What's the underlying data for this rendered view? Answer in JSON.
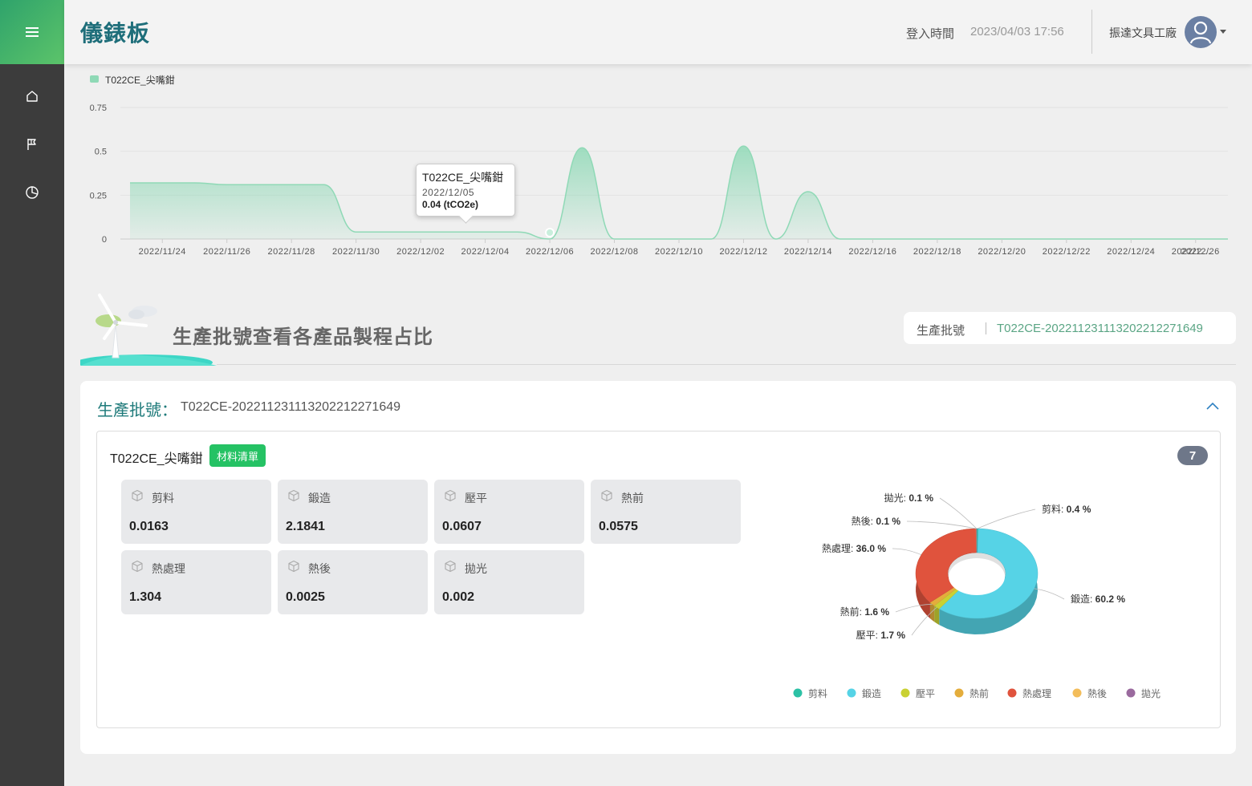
{
  "header": {
    "title": "儀錶板",
    "login_label": "登入時間",
    "login_time": "2023/04/03 17:56",
    "user_name": "振達文具工廠"
  },
  "sidebar": {
    "items": [
      {
        "icon": "home-icon"
      },
      {
        "icon": "flag-icon"
      },
      {
        "icon": "pie-chart-icon"
      }
    ]
  },
  "chart_data": {
    "type": "area",
    "series": [
      {
        "name": "T022CE_尖嘴鉗",
        "x": [
          "2022/11/23",
          "2022/11/24",
          "2022/11/25",
          "2022/11/26",
          "2022/11/27",
          "2022/11/28",
          "2022/11/29",
          "2022/11/30",
          "2022/12/01",
          "2022/12/02",
          "2022/12/03",
          "2022/12/04",
          "2022/12/05",
          "2022/12/06",
          "2022/12/07",
          "2022/12/08",
          "2022/12/09",
          "2022/12/10",
          "2022/12/11",
          "2022/12/12",
          "2022/12/13",
          "2022/12/14",
          "2022/12/15",
          "2022/12/16",
          "2022/12/17",
          "2022/12/18",
          "2022/12/19",
          "2022/12/20",
          "2022/12/21",
          "2022/12/22",
          "2022/12/23",
          "2022/12/24",
          "2022/12/25",
          "2022/12/26",
          "2022/12/27"
        ],
        "values": [
          0.32,
          0.32,
          0.32,
          0.31,
          0.31,
          0.31,
          0.31,
          0.04,
          0.04,
          0.04,
          0.04,
          0.04,
          0.04,
          0,
          0.52,
          0,
          0,
          0,
          0,
          0.53,
          0,
          0.27,
          0,
          0,
          0,
          0,
          0,
          0,
          0,
          0,
          0,
          0,
          0,
          0,
          0
        ]
      }
    ],
    "x_tick_labels": [
      "2022/11/24",
      "2022/11/26",
      "2022/11/28",
      "2022/11/30",
      "2022/12/02",
      "2022/12/04",
      "2022/12/06",
      "2022/12/08",
      "2022/12/10",
      "2022/12/12",
      "2022/12/14",
      "2022/12/16",
      "2022/12/18",
      "2022/12/20",
      "2022/12/22",
      "2022/12/24",
      "2022/12/26",
      "2022..."
    ],
    "y_ticks": [
      "0",
      "0.25",
      "0.5",
      "0.75"
    ],
    "ylim": [
      0,
      0.75
    ],
    "legend": "top-left",
    "grid": true,
    "color": "#8fd9b6",
    "tooltip": {
      "title": "T022CE_尖嘴鉗",
      "date": "2022/12/05",
      "value": "0.04 (tCO2e)"
    }
  },
  "section": {
    "title": "生產批號查看各產品製程占比",
    "batch_label": "生產批號",
    "batch_value": "T022CE-20221123111320221227164​9"
  },
  "card": {
    "label": "生產批號：",
    "batch": "T022CE-20221123111320221227164​9",
    "product": "T022CE_尖嘴鉗",
    "bom_button": "材料清單",
    "count": "7",
    "processes": [
      {
        "name": "剪料",
        "value": "0.0163"
      },
      {
        "name": "鍛造",
        "value": "2.1841"
      },
      {
        "name": "壓平",
        "value": "0.0607"
      },
      {
        "name": "熱前",
        "value": "0.0575"
      },
      {
        "name": "熱處理",
        "value": "1.304"
      },
      {
        "name": "熱後",
        "value": "0.0025"
      },
      {
        "name": "拋光",
        "value": "0.002"
      }
    ]
  },
  "pie_chart": {
    "type": "pie",
    "slices": [
      {
        "name": "剪料",
        "pct": "0.4",
        "color": "#2cc1a5"
      },
      {
        "name": "鍛造",
        "pct": "60.2",
        "color": "#56d3e6"
      },
      {
        "name": "壓平",
        "pct": "1.7",
        "color": "#c9d133"
      },
      {
        "name": "熱前",
        "pct": "1.6",
        "color": "#e4ad3c"
      },
      {
        "name": "熱處理",
        "pct": "36.0",
        "color": "#e0533d"
      },
      {
        "name": "熱後",
        "pct": "0.1",
        "color": "#f3bd5b"
      },
      {
        "name": "拋光",
        "pct": "0.1",
        "color": "#9a6a9e"
      }
    ],
    "unit": "%"
  }
}
